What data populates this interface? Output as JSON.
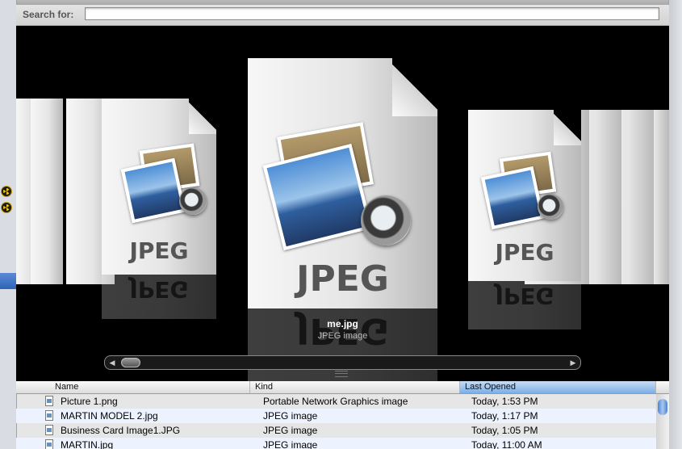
{
  "search": {
    "label": "Search for:",
    "value": ""
  },
  "coverflow": {
    "selected_name": "me.jpg",
    "selected_kind": "JPEG image",
    "doc_label": "JPEG",
    "doc_label_reflected": "JPEG"
  },
  "scroll": {
    "left": "◀",
    "right": "▶"
  },
  "columns": [
    "Name",
    "Kind",
    "Last Opened"
  ],
  "sorted_column": "Last Opened",
  "files": [
    {
      "name": "Picture 1.png",
      "kind": "Portable Network Graphics image",
      "opened": "Today, 1:53 PM"
    },
    {
      "name": "MARTIN MODEL 2.jpg",
      "kind": "JPEG image",
      "opened": "Today, 1:17 PM"
    },
    {
      "name": "Business Card Image1.JPG",
      "kind": "JPEG image",
      "opened": "Today, 1:05 PM"
    },
    {
      "name": "MARTIN.jpg",
      "kind": "JPEG image",
      "opened": "Today, 11:00 AM"
    }
  ],
  "colors": {
    "selection": "#2e63b8",
    "sorted_header": "#7aaee6",
    "alt_row": "#edf3fe"
  }
}
